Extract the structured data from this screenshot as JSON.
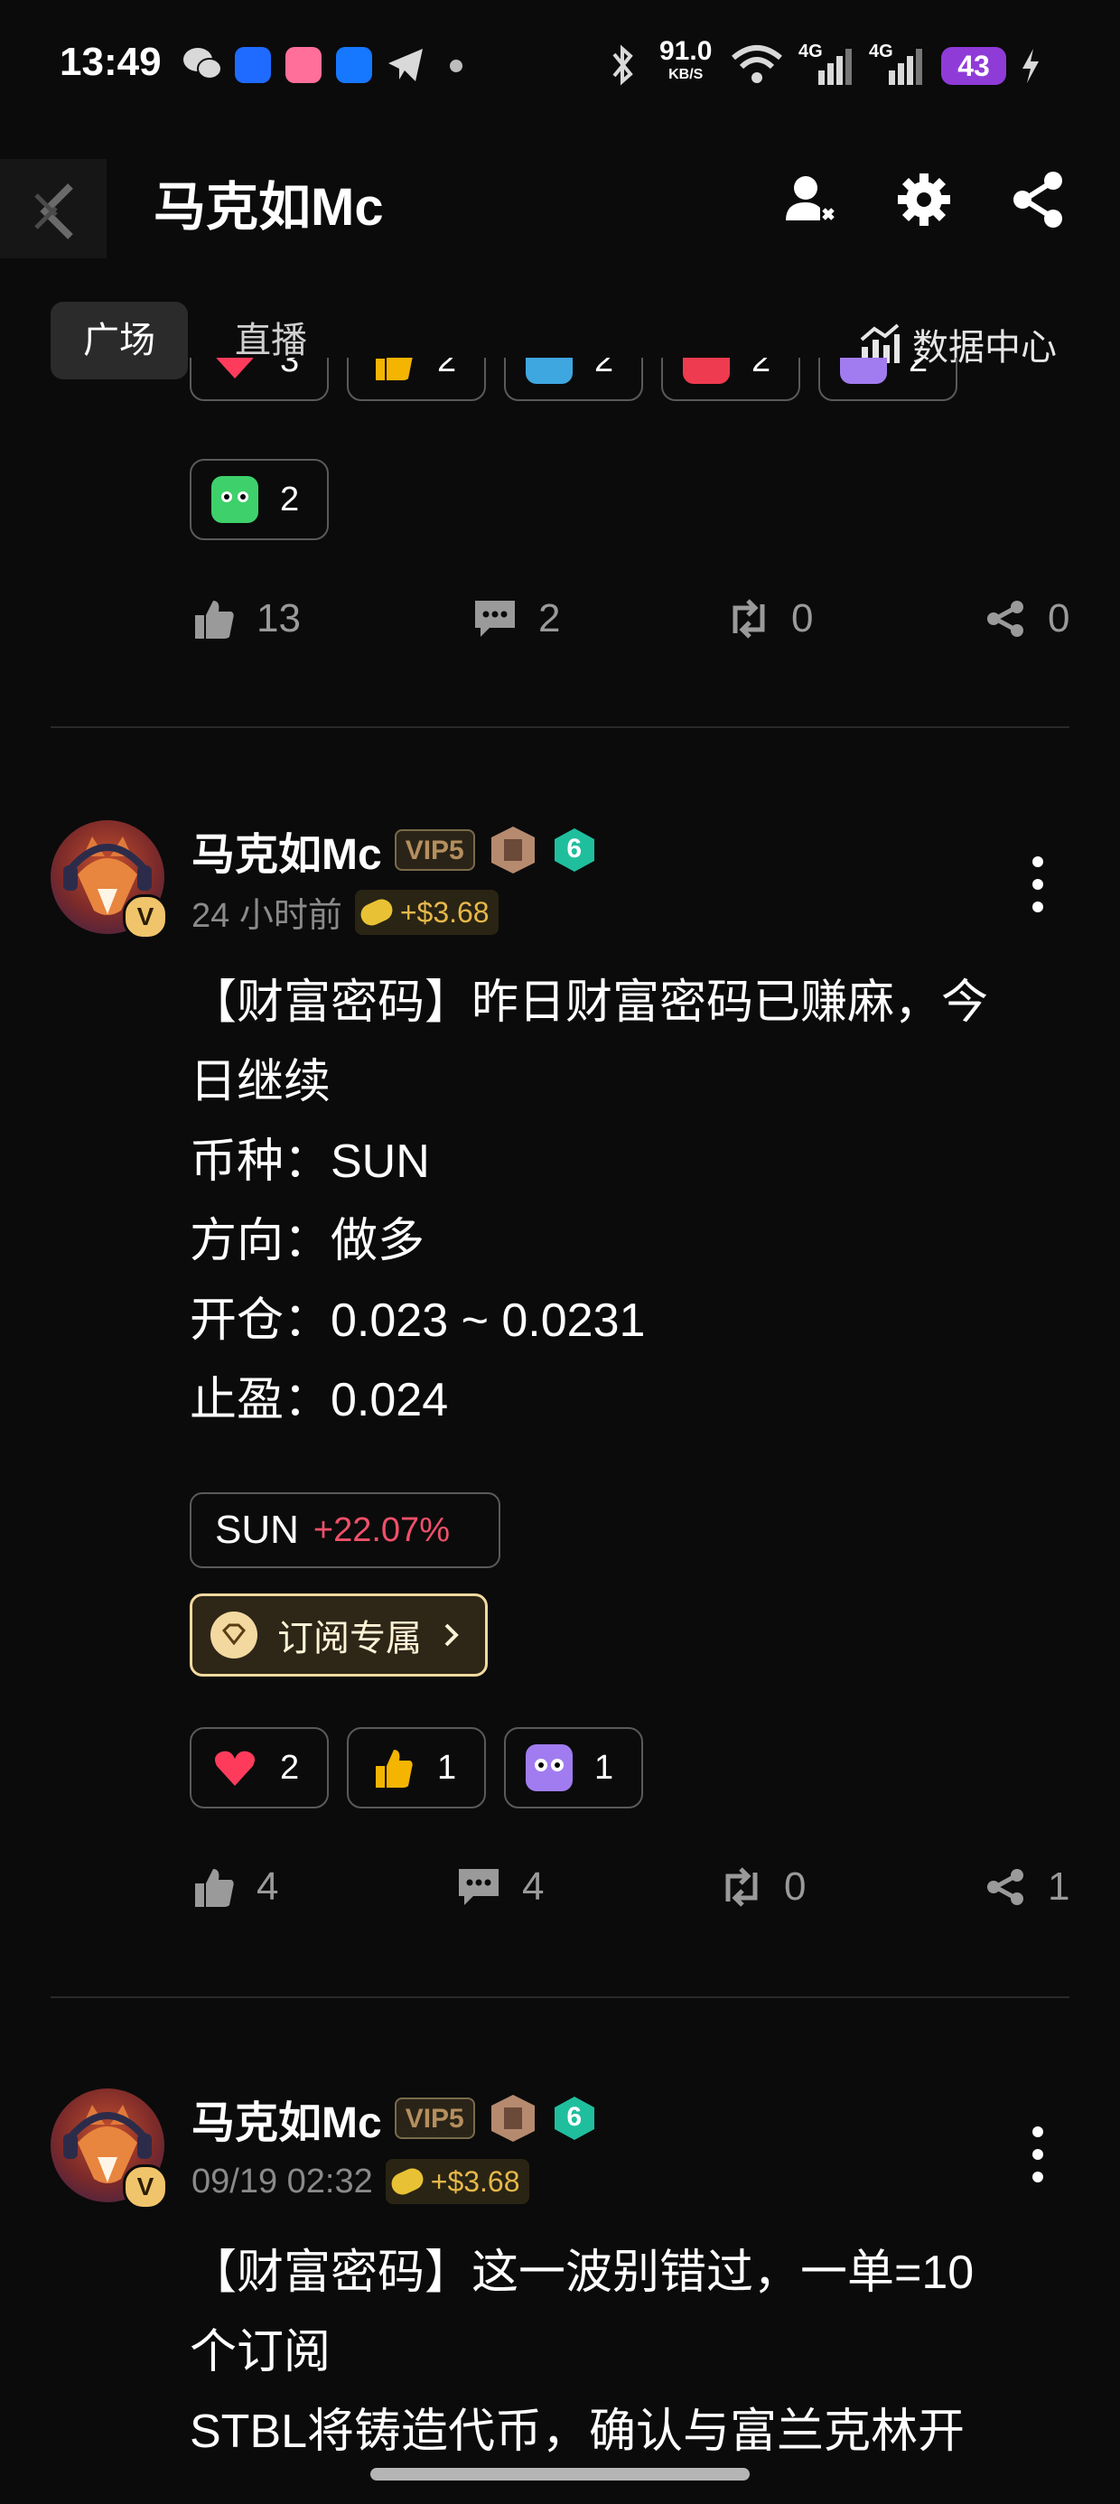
{
  "status_bar": {
    "time": "13:49",
    "speed_value": "91.0",
    "speed_unit": "KB/S",
    "battery": "43",
    "network_labels": [
      "4G",
      "4G"
    ],
    "app_icons": [
      "wechat-icon",
      "app-blue-icon",
      "lolita-app-icon",
      "alipay-icon",
      "telegram-icon"
    ]
  },
  "header": {
    "title": "马克如Mc",
    "icons": [
      "profile-follow-icon",
      "settings-icon",
      "share-icon"
    ]
  },
  "tabs": [
    {
      "label": "广场",
      "active": true
    },
    {
      "label": "直播",
      "active": false
    }
  ],
  "data_center": {
    "label": "数据中心"
  },
  "prev_post": {
    "reactions": [
      {
        "emoji": "heart",
        "count": "3"
      },
      {
        "emoji": "thumbs-up",
        "count": "2"
      },
      {
        "emoji": "hodl",
        "count": "2"
      },
      {
        "emoji": "red-face",
        "count": "2"
      },
      {
        "emoji": "purple-face",
        "count": "2"
      },
      {
        "emoji": "green-face",
        "count": "2"
      }
    ],
    "stats": {
      "likes": "13",
      "comments": "2",
      "reposts": "0",
      "shares": "0"
    }
  },
  "posts": [
    {
      "author": "马克如Mc",
      "vip": "VIP5",
      "level": "6",
      "time": "24 小时前",
      "tip": "+$3.68",
      "lines": [
        "【财富密码】昨日财富密码已赚麻，今",
        "日继续",
        "币种：SUN",
        "方向：做多",
        "开仓：0.023 ~ 0.0231",
        "止盈：0.024"
      ],
      "ticker": {
        "symbol": "SUN",
        "change": "+22.07%"
      },
      "subscribe_label": "订阅专属",
      "reactions": [
        {
          "emoji": "heart",
          "count": "2"
        },
        {
          "emoji": "thumbs-up",
          "count": "1"
        },
        {
          "emoji": "purple-face",
          "count": "1"
        }
      ],
      "stats": {
        "likes": "4",
        "comments": "4",
        "reposts": "0",
        "shares": "1"
      }
    },
    {
      "author": "马克如Mc",
      "vip": "VIP5",
      "level": "6",
      "time": "09/19 02:32",
      "tip": "+$3.68",
      "lines": [
        "【财富密码】这一波别错过，一单=10",
        "个订阅",
        "STBL将铸造代币，确认与富兰克林开"
      ]
    }
  ],
  "colors": {
    "background": "#0b0b0b",
    "price_up": "#f0506a",
    "vip_gold": "#b58f5e",
    "level_teal": "#1fbf9e",
    "tip_gold": "#e6b84a"
  }
}
